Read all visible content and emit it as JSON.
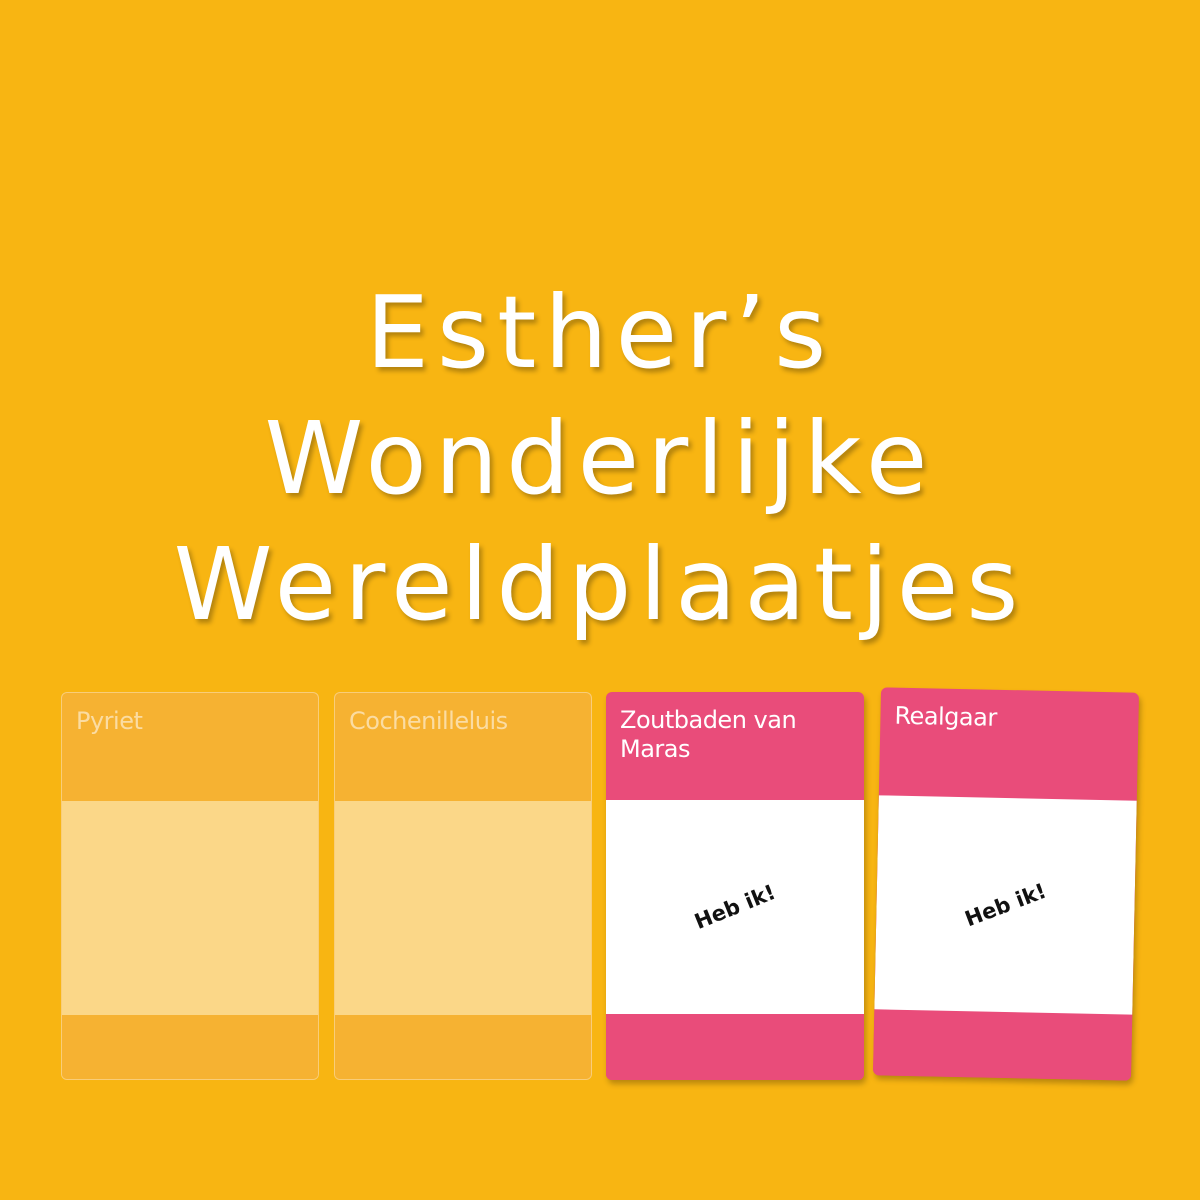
{
  "title": {
    "line1": "Esther’s",
    "line2": "Wonderlijke",
    "line3": "Wereldplaatjes"
  },
  "cards": [
    {
      "name": "Pyriet",
      "status": ""
    },
    {
      "name": "Cochenilleluis",
      "status": ""
    },
    {
      "name": "Zoutbaden van Maras",
      "status": "Heb ik!"
    },
    {
      "name": "Realgaar",
      "status": "Heb ik!"
    }
  ],
  "colors": {
    "background": "#F8B512",
    "card_accent": "#E94C7A",
    "card_empty": "#F6B232"
  }
}
